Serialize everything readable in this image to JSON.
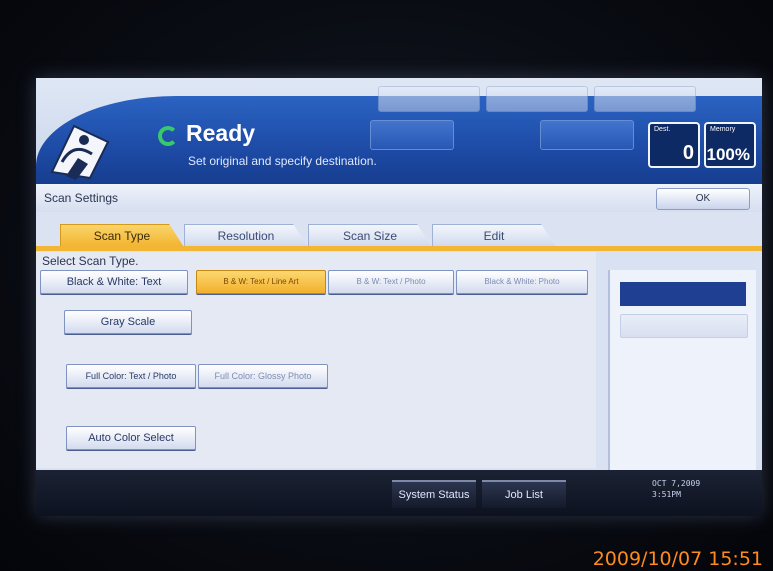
{
  "header": {
    "status_title": "Ready",
    "status_message": "Set original and specify destination.",
    "counters": [
      {
        "label": "Dest.",
        "value": "0"
      },
      {
        "label": "Memory",
        "value": "100%"
      }
    ]
  },
  "settings": {
    "title": "Scan Settings",
    "ok_label": "OK"
  },
  "tabs": [
    {
      "label": "Scan Type"
    },
    {
      "label": "Resolution"
    },
    {
      "label": "Scan Size"
    },
    {
      "label": "Edit"
    }
  ],
  "scan_type": {
    "prompt": "Select Scan Type.",
    "options": [
      "Black & White: Text",
      "B & W: Text / Line Art",
      "B & W: Text / Photo",
      "Black & White: Photo",
      "Gray Scale",
      "Full Color: Text / Photo",
      "Full Color: Glossy Photo",
      "Auto Color Select"
    ],
    "selected": "B & W: Text / Line Art"
  },
  "status_bar": {
    "system_status_label": "System Status",
    "job_list_label": "Job List",
    "clock_date": "OCT  7,2009",
    "clock_time": "3:51PM"
  },
  "photo_timestamp": "2009/10/07 15:51",
  "colors": {
    "accent": "#f2b634",
    "banner": "#1d4ba6",
    "ready_indicator": "#39c96a"
  }
}
